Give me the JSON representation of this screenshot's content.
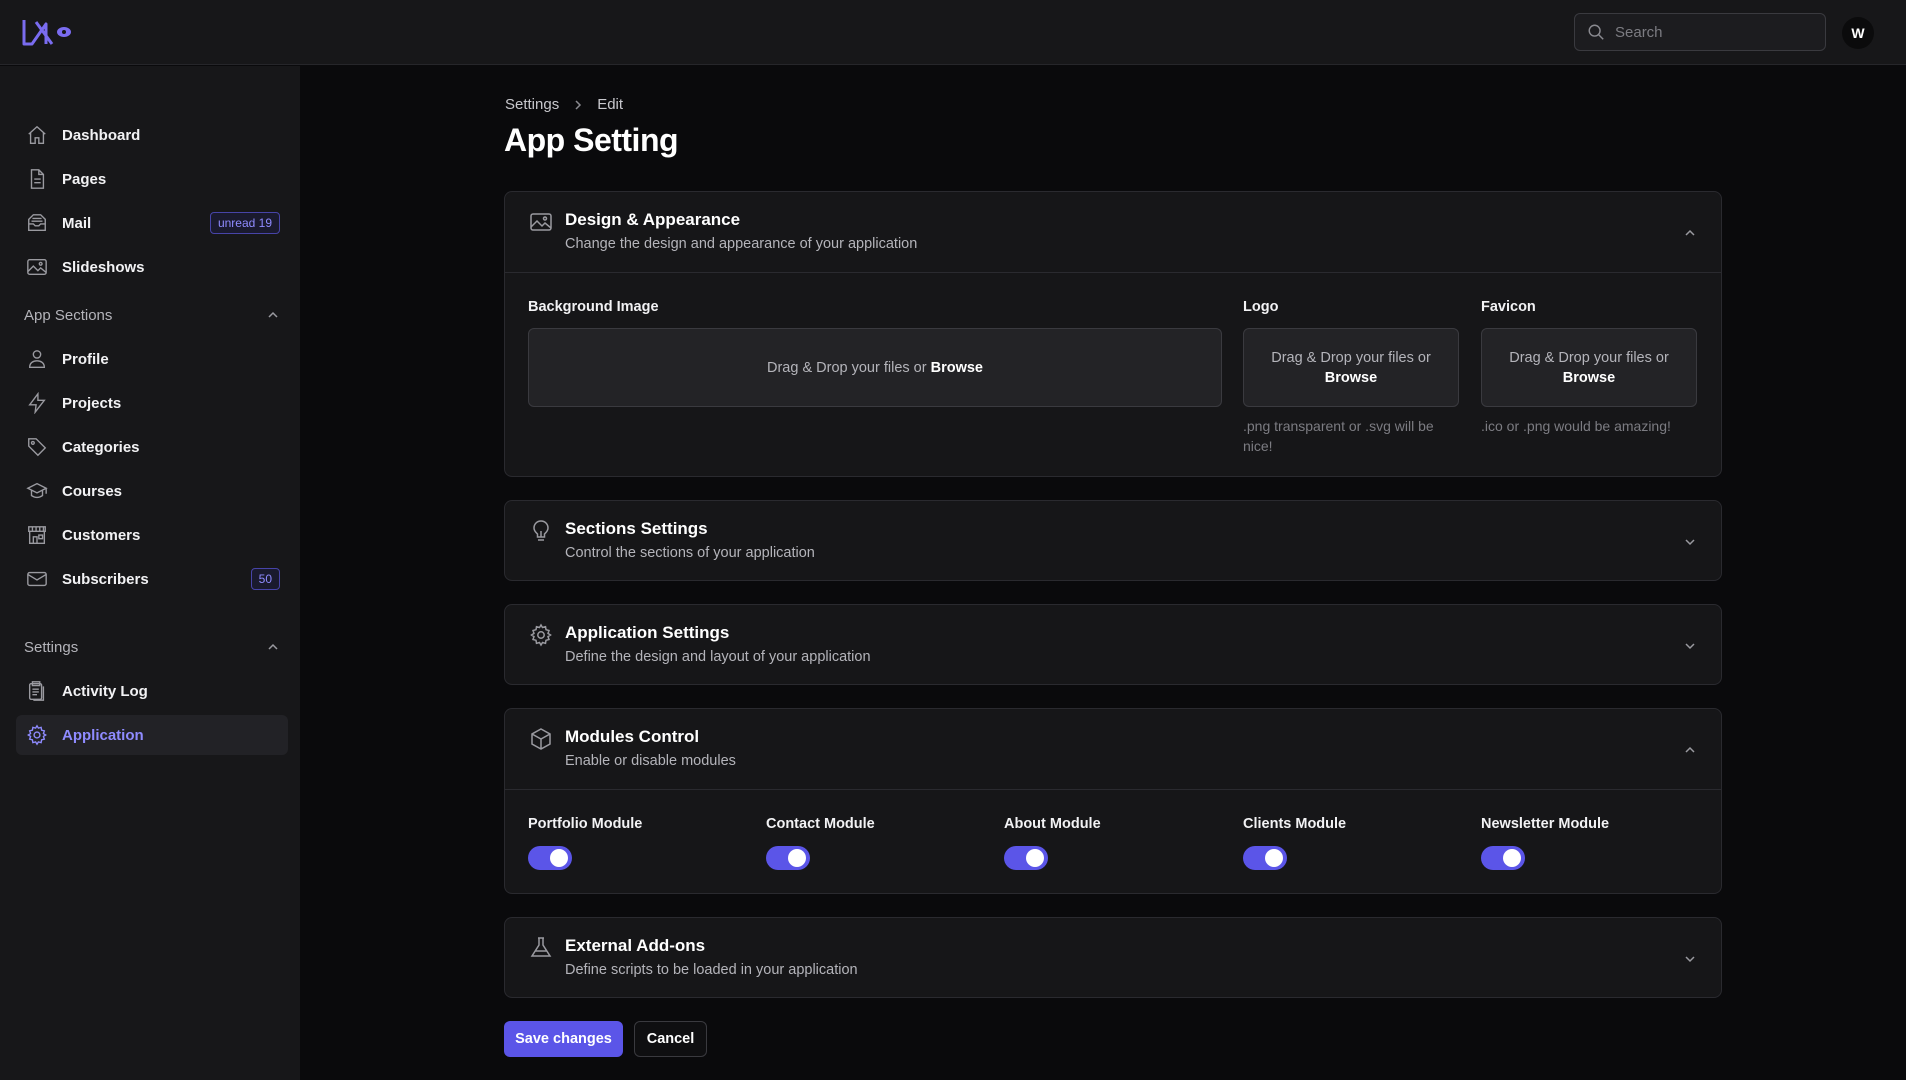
{
  "brand": {
    "accent": "#5b55e8",
    "accent_text": "#8f8bff",
    "logo_icon": "brand-logo"
  },
  "header": {
    "search": {
      "placeholder": "Search",
      "value": "",
      "icon": "search-icon"
    },
    "avatar_initial": "W"
  },
  "sidebar": {
    "main_items": [
      {
        "label": "Dashboard",
        "icon": "home-icon"
      },
      {
        "label": "Pages",
        "icon": "document-icon"
      },
      {
        "label": "Mail",
        "icon": "inbox-icon",
        "badge": "unread 19"
      },
      {
        "label": "Slideshows",
        "icon": "image-icon"
      }
    ],
    "app_sections": {
      "title": "App Sections",
      "items": [
        {
          "label": "Profile",
          "icon": "user-icon"
        },
        {
          "label": "Projects",
          "icon": "bolt-icon"
        },
        {
          "label": "Categories",
          "icon": "tag-icon"
        },
        {
          "label": "Courses",
          "icon": "graduation-cap-icon"
        },
        {
          "label": "Customers",
          "icon": "storefront-icon"
        },
        {
          "label": "Subscribers",
          "icon": "envelope-icon",
          "badge": "50"
        }
      ]
    },
    "settings": {
      "title": "Settings",
      "items": [
        {
          "label": "Activity Log",
          "icon": "clipboard-icon"
        },
        {
          "label": "Application",
          "icon": "gear-icon",
          "active": true
        }
      ]
    }
  },
  "breadcrumb": [
    "Settings",
    "Edit"
  ],
  "page_title": "App Setting",
  "sections": {
    "design": {
      "title": "Design & Appearance",
      "subtitle": "Change the design and appearance of your application",
      "expanded": true,
      "background_label": "Background Image",
      "logo_label": "Logo",
      "favicon_label": "Favicon",
      "drop_text": "Drag & Drop your files or",
      "browse": "Browse",
      "logo_hint": ".png transparent or .svg will be nice!",
      "favicon_hint": ".ico or .png would be amazing!"
    },
    "sections_settings": {
      "title": "Sections Settings",
      "subtitle": "Control the sections of your application",
      "expanded": false
    },
    "application_settings": {
      "title": "Application Settings",
      "subtitle": "Define the design and layout of your application",
      "expanded": false
    },
    "modules": {
      "title": "Modules Control",
      "subtitle": "Enable or disable modules",
      "expanded": true,
      "items": [
        {
          "label": "Portfolio Module",
          "enabled": true
        },
        {
          "label": "Contact Module",
          "enabled": true
        },
        {
          "label": "About Module",
          "enabled": true
        },
        {
          "label": "Clients Module",
          "enabled": true
        },
        {
          "label": "Newsletter Module",
          "enabled": true
        }
      ]
    },
    "addons": {
      "title": "External Add-ons",
      "subtitle": "Define scripts to be loaded in your application",
      "expanded": false
    }
  },
  "actions": {
    "save": "Save changes",
    "cancel": "Cancel"
  }
}
